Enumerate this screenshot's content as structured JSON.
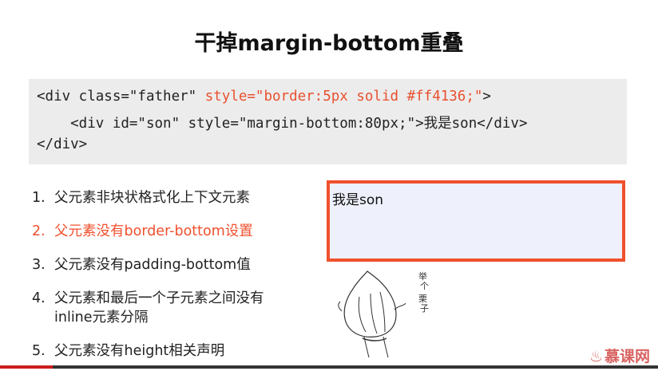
{
  "slide": {
    "title": "干掉margin-bottom重叠"
  },
  "code": {
    "line1_a": "<div class=\"father\" ",
    "line1_b": "style=\"border:5px solid #ff4136;\"",
    "line1_c": ">",
    "line2": "    <div id=\"son\" style=\"margin-bottom:80px;\">我是son</div>",
    "line3": "</div>"
  },
  "list": [
    {
      "num": "1.",
      "text": "父元素非块状格式化上下文元素"
    },
    {
      "num": "2.",
      "text": "父元素没有border-bottom设置"
    },
    {
      "num": "3.",
      "text": "父元素没有padding-bottom值"
    },
    {
      "num": "4.",
      "text": "父元素和最后一个子元素之间没有inline元素分隔"
    },
    {
      "num": "5.",
      "text": "父元素没有height相关声明"
    }
  ],
  "demo": {
    "son_text": "我是son",
    "border_color": "#f0502d"
  },
  "sketch": {
    "caption": "举个栗子"
  },
  "watermark": {
    "icon": "flame-icon",
    "text": "慕课网"
  },
  "video": {
    "progress_fraction": 0.08
  },
  "colors": {
    "accent": "#f0502d",
    "code_bg": "#ececec"
  }
}
